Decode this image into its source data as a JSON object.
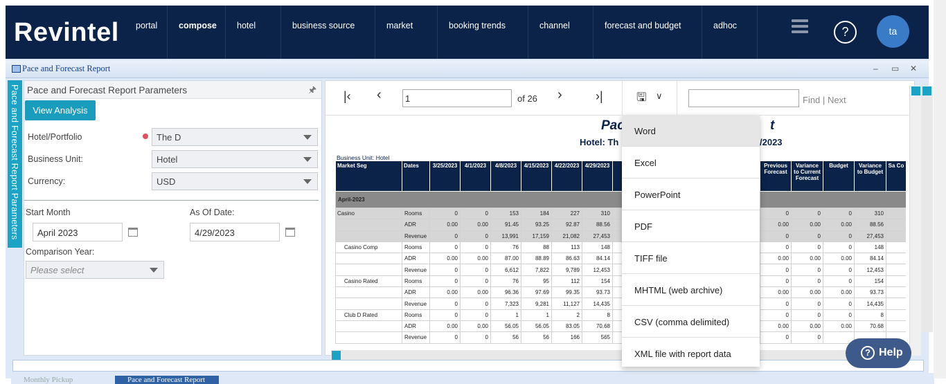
{
  "brand": "Revintel",
  "nav": [
    {
      "label": "portal",
      "active": false
    },
    {
      "label": "compose",
      "active": true
    },
    {
      "label": "hotel",
      "active": false
    },
    {
      "label": "business source",
      "active": false
    },
    {
      "label": "market",
      "active": false
    },
    {
      "label": "booking trends",
      "active": false
    },
    {
      "label": "channel",
      "active": false
    },
    {
      "label": "forecast and budget",
      "active": false
    },
    {
      "label": "adhoc",
      "active": false
    }
  ],
  "help_symbol": "?",
  "user_initials": "ta",
  "window": {
    "title": "Pace and Forecast Report",
    "controls": [
      "–",
      "▭",
      "✕"
    ]
  },
  "params": {
    "side_tab": "Pace and Forecast Report Parameters",
    "header": "Pace and Forecast Report Parameters",
    "view_button": "View Analysis",
    "hotel_label": "Hotel/Portfolio",
    "hotel_value": "The D",
    "business_unit_label": "Business Unit:",
    "business_unit_value": "Hotel",
    "currency_label": "Currency:",
    "currency_value": "USD",
    "start_month_label": "Start Month",
    "start_month_value": "April 2023",
    "as_of_label": "As Of Date:",
    "as_of_value": "4/29/2023",
    "comparison_label": "Comparison Year:",
    "comparison_placeholder": "Please select"
  },
  "viewer": {
    "page_value": "1",
    "of_pages": "of 26",
    "find_label": "Find",
    "sep": "|",
    "next_label": "Next"
  },
  "report": {
    "title_left": "Pac",
    "title_right": "t",
    "subtitle_left": "Hotel: Th",
    "subtitle_right": "/2023",
    "business_unit": "Business Unit: Hotel",
    "headers_left": [
      "Market Seg",
      "Dates",
      "3/25/2023",
      "4/1/2023",
      "4/8/2023",
      "4/15/2023",
      "4/22/2023",
      "4/29/2023"
    ],
    "headers_right": [
      "Previous Forecast",
      "Variance to Current Forecast",
      "Budget",
      "Variance to Budget",
      "Sa Co"
    ],
    "month": "April-2023",
    "rows": [
      {
        "seg": "Casino",
        "metric": "Rooms",
        "v": [
          "0",
          "0",
          "153",
          "184",
          "227",
          "310"
        ],
        "r": [
          "0",
          "0",
          "0",
          "310"
        ],
        "shade": true
      },
      {
        "seg": "",
        "metric": "ADR",
        "v": [
          "0.00",
          "0.00",
          "91.45",
          "93.25",
          "92.87",
          "88.56"
        ],
        "r": [
          "0.00",
          "0.00",
          "0.00",
          "88.56"
        ],
        "shade": true
      },
      {
        "seg": "",
        "metric": "Revenue",
        "v": [
          "0",
          "0",
          "13,991",
          "17,159",
          "21,082",
          "27,453"
        ],
        "r": [
          "0",
          "0",
          "0",
          "27,453"
        ],
        "shade": true
      },
      {
        "seg": "Casino Comp",
        "metric": "Rooms",
        "v": [
          "0",
          "0",
          "76",
          "88",
          "113",
          "148"
        ],
        "r": [
          "0",
          "0",
          "0",
          "148"
        ],
        "shade": false
      },
      {
        "seg": "",
        "metric": "ADR",
        "v": [
          "0.00",
          "0.00",
          "87.00",
          "88.89",
          "86.63",
          "84.14"
        ],
        "r": [
          "0.00",
          "0.00",
          "0.00",
          "84.14"
        ],
        "shade": false
      },
      {
        "seg": "",
        "metric": "Revenue",
        "v": [
          "0",
          "0",
          "6,612",
          "7,822",
          "9,789",
          "12,453"
        ],
        "r": [
          "0",
          "0",
          "0",
          "12,453"
        ],
        "shade": false
      },
      {
        "seg": "Casino Rated",
        "metric": "Rooms",
        "v": [
          "0",
          "0",
          "76",
          "95",
          "112",
          "154"
        ],
        "r": [
          "0",
          "0",
          "0",
          "154"
        ],
        "shade": false
      },
      {
        "seg": "",
        "metric": "ADR",
        "v": [
          "0.00",
          "0.00",
          "96.36",
          "97.69",
          "99.35",
          "93.73"
        ],
        "r": [
          "0.00",
          "0.00",
          "0.00",
          "93.73"
        ],
        "shade": false
      },
      {
        "seg": "",
        "metric": "Revenue",
        "v": [
          "0",
          "0",
          "7,323",
          "9,281",
          "11,127",
          "14,435"
        ],
        "r": [
          "0",
          "0",
          "0",
          "14,435"
        ],
        "shade": false
      },
      {
        "seg": "Club D Rated",
        "metric": "Rooms",
        "v": [
          "0",
          "0",
          "1",
          "1",
          "2",
          "8"
        ],
        "r": [
          "0",
          "0",
          "0",
          "8"
        ],
        "shade": false
      },
      {
        "seg": "",
        "metric": "ADR",
        "v": [
          "0.00",
          "0.00",
          "56.05",
          "56.05",
          "83.05",
          "70.68"
        ],
        "r": [
          "0.00",
          "0.00",
          "0.00",
          "70.68"
        ],
        "shade": false
      },
      {
        "seg": "",
        "metric": "Revenue",
        "v": [
          "0",
          "0",
          "56",
          "56",
          "166",
          "565"
        ],
        "r": [
          "0",
          "0",
          "",
          " "
        ],
        "shade": false
      }
    ]
  },
  "export_menu": [
    "Word",
    "Excel",
    "PowerPoint",
    "PDF",
    "TIFF file",
    "MHTML (web archive)",
    "CSV (comma delimited)",
    "XML file with report data"
  ],
  "help_button": "Help",
  "tasks": [
    "Monthly Pickup",
    "Pace and Forecast Report"
  ]
}
